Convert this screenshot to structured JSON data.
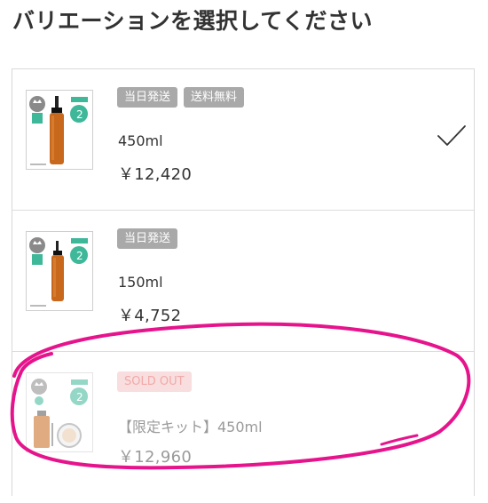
{
  "page": {
    "title": "バリエーションを選択してください"
  },
  "variations": [
    {
      "badges": [
        "当日発送",
        "送料無料"
      ],
      "size": "450ml",
      "price": "￥12,420",
      "selected": true,
      "sold_out": false,
      "thumb_rank_number": "2"
    },
    {
      "badges": [
        "当日発送"
      ],
      "size": "150ml",
      "price": "￥4,752",
      "selected": false,
      "sold_out": false,
      "thumb_rank_number": "2"
    },
    {
      "badges": [
        "SOLD OUT"
      ],
      "size": "【限定キット】450ml",
      "price": "￥12,960",
      "selected": false,
      "sold_out": true,
      "thumb_rank_number": "2"
    }
  ],
  "colors": {
    "badge_bg": "#a9a9a9",
    "soldout_badge_bg": "#f8dede",
    "soldout_badge_text": "#f2a9a9",
    "annotation_magenta": "#e6148c",
    "bottle_amber": "#c8681c",
    "rank_green": "#3fb89a"
  },
  "icons": {
    "selected": "checkmark-icon"
  }
}
